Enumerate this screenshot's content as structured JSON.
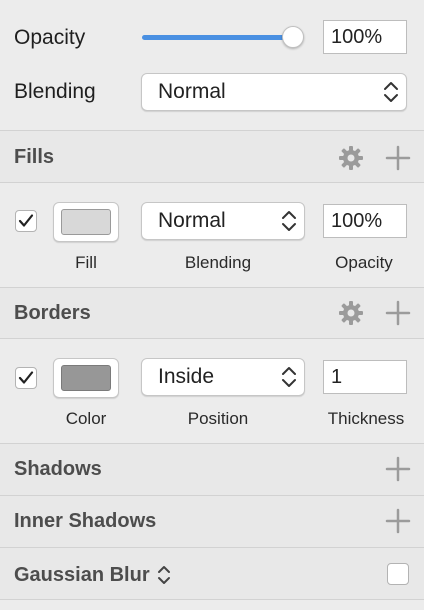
{
  "layer": {
    "opacity_label": "Opacity",
    "opacity_value": "100%",
    "opacity_fraction": 1.0,
    "blending_label": "Blending",
    "blending_value": "Normal"
  },
  "fills": {
    "title": "Fills",
    "row": {
      "enabled": true,
      "color": "#d8d8d8",
      "blending_value": "Normal",
      "opacity_value": "100%",
      "fill_caption": "Fill",
      "blending_caption": "Blending",
      "opacity_caption": "Opacity"
    }
  },
  "borders": {
    "title": "Borders",
    "row": {
      "enabled": true,
      "color": "#979797",
      "position_value": "Inside",
      "thickness_value": "1",
      "color_caption": "Color",
      "position_caption": "Position",
      "thickness_caption": "Thickness"
    }
  },
  "shadows": {
    "title": "Shadows"
  },
  "inner_shadows": {
    "title": "Inner Shadows"
  },
  "gaussian_blur": {
    "title": "Gaussian Blur",
    "enabled": false
  },
  "colors": {
    "accent": "#4a90e2",
    "icon_gray": "#9b9b9b"
  }
}
